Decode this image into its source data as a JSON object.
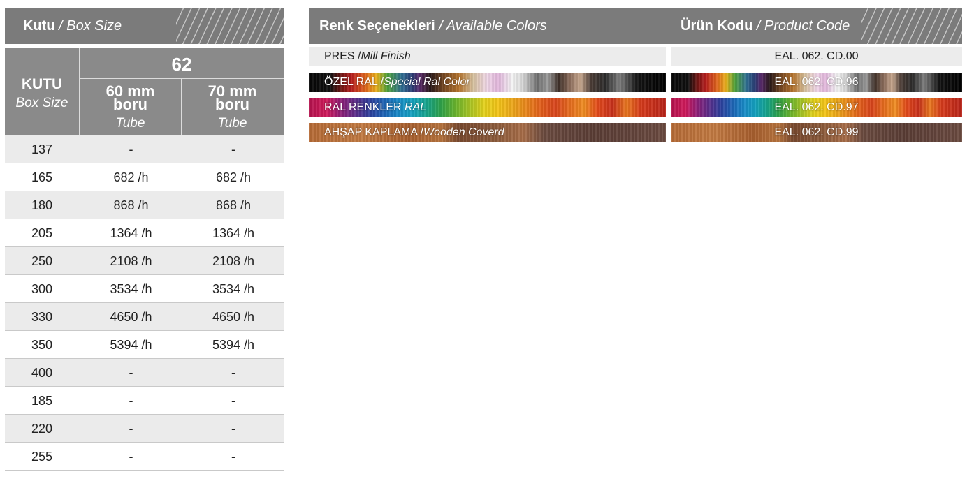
{
  "size_panel": {
    "header": {
      "title_bold": "Kutu",
      "title_italic": "/ Box Size"
    },
    "table": {
      "corner": {
        "main": "KUTU",
        "sub": "Box Size"
      },
      "group": "62",
      "columns": [
        {
          "size": "60 mm",
          "word": "boru",
          "sub": "Tube"
        },
        {
          "size": "70 mm",
          "word": "boru",
          "sub": "Tube"
        }
      ],
      "rows": [
        {
          "box": "137",
          "a": "-",
          "b": "-"
        },
        {
          "box": "165",
          "a": "682 /h",
          "b": "682 /h"
        },
        {
          "box": "180",
          "a": "868 /h",
          "b": "868 /h"
        },
        {
          "box": "205",
          "a": "1364 /h",
          "b": "1364 /h"
        },
        {
          "box": "250",
          "a": "2108 /h",
          "b": "2108 /h"
        },
        {
          "box": "300",
          "a": "3534 /h",
          "b": "3534 /h"
        },
        {
          "box": "330",
          "a": "4650 /h",
          "b": "4650 /h"
        },
        {
          "box": "350",
          "a": "5394 /h",
          "b": "5394 /h"
        },
        {
          "box": "400",
          "a": "-",
          "b": "-"
        },
        {
          "box": "185",
          "a": "-",
          "b": "-"
        },
        {
          "box": "220",
          "a": "-",
          "b": "-"
        },
        {
          "box": "255",
          "a": "-",
          "b": "-"
        }
      ]
    }
  },
  "colors_panel": {
    "header": {
      "colors_bold": "Renk Seçenekleri",
      "colors_italic": "/ Available Colors",
      "code_bold": "Ürün Kodu",
      "code_italic": "/ Product Code"
    },
    "options": [
      {
        "name": "PRES /",
        "name_italic": "Mill Finish",
        "code": "EAL. 062. CD.00",
        "swatch": "mill"
      },
      {
        "name": "ÖZEL RAL /",
        "name_italic": "Special Ral Color",
        "code": "EAL. 062. CD.96",
        "swatch": "special"
      },
      {
        "name": "RAL RENKLER",
        "name_italic": " RAL",
        "code": "EAL. 062. CD.97",
        "swatch": "ral"
      },
      {
        "name": "AHŞAP KAPLAMA /",
        "name_italic": "Wooden Coverd",
        "code": "EAL. 062. CD.99",
        "swatch": "wood"
      }
    ]
  },
  "colors": {
    "header_bg": "#7b7b7b",
    "table_head_bg": "#8a8a8a",
    "row_alt_bg": "#ebebeb",
    "mill_bg": "#ececec"
  }
}
